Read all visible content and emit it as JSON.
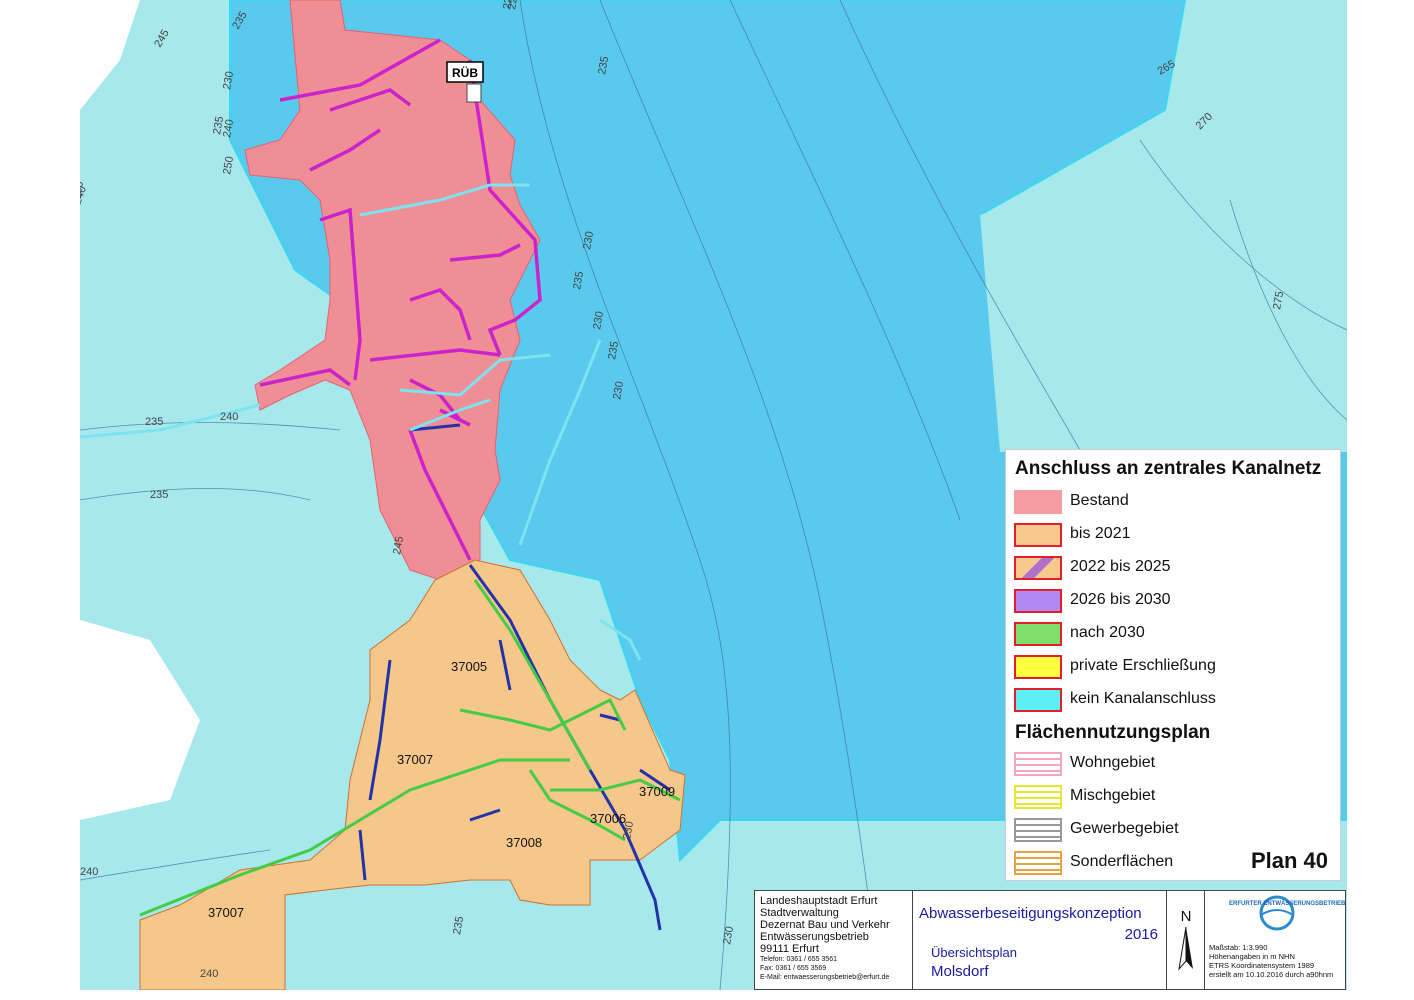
{
  "map": {
    "marker_label": "RÜB",
    "contour_labels": [
      "245",
      "235",
      "230",
      "240",
      "250",
      "225",
      "235",
      "240",
      "235",
      "240",
      "235",
      "245",
      "235",
      "265",
      "270",
      "275",
      "230",
      "235",
      "230",
      "235",
      "240",
      "240",
      "235",
      "230",
      "230",
      "250",
      "230",
      "225"
    ],
    "zone_labels": [
      "37005",
      "37007",
      "37009",
      "37006",
      "37008",
      "37007"
    ],
    "colors": {
      "background_outside": "#a6e8ec",
      "catchment": "#5ac9ee",
      "bestand": "#ef8f95",
      "bis_2021": "#f5c78a",
      "pipe_magenta": "#cc22cc",
      "pipe_blue": "#2233aa",
      "pipe_green": "#44cc44",
      "pipe_cyan": "#7de3f0"
    }
  },
  "legend": {
    "title_connection": "Anschluss an zentrales Kanalnetz",
    "items_connection": [
      {
        "label": "Bestand",
        "fill": "#f59ca0",
        "border": "#f59ca0"
      },
      {
        "label": "bis 2021",
        "fill": "#f7c98c",
        "border": "#e0202a"
      },
      {
        "label": "2022 bis 2025",
        "fill": "#f7c98c",
        "border": "#e0202a",
        "stripe": "#b070d0"
      },
      {
        "label": "2026 bis 2030",
        "fill": "#b388f0",
        "border": "#e0202a"
      },
      {
        "label": "nach 2030",
        "fill": "#7ee06a",
        "border": "#e0202a"
      },
      {
        "label": "private Erschließung",
        "fill": "#ffff40",
        "border": "#e0202a"
      },
      {
        "label": "kein Kanalanschluss",
        "fill": "#5eeef6",
        "border": "#e0202a"
      }
    ],
    "title_land_use": "Flächennutzungsplan",
    "items_land_use": [
      {
        "label": "Wohngebiet",
        "color": "#f2a6c0"
      },
      {
        "label": "Mischgebiet",
        "color": "#e6e630"
      },
      {
        "label": "Gewerbegebiet",
        "color": "#999999"
      },
      {
        "label": "Sonderflächen",
        "color": "#e8a040"
      }
    ],
    "plan_label": "Plan 40"
  },
  "titleblock": {
    "org_lines": [
      "Landeshauptstadt Erfurt",
      "Stadtverwaltung",
      "Dezernat Bau und Verkehr",
      "Entwässerungsbetrieb",
      "99111 Erfurt"
    ],
    "org_small": [
      "Telefon: 0361 / 655 3561",
      "Fax:      0361 / 655 3569",
      "E-Mail: entwaesserungsbetrieb@erfurt.de"
    ],
    "project_title": "Abwasserbeseitigungskonzeption",
    "project_year": "2016",
    "plan_type": "Übersichtsplan",
    "locality": "Molsdorf",
    "north_label": "N",
    "logo_text": "ERFURTER ENTWÄSSERUNGSBETRIEB",
    "meta_lines": [
      "Maßstab:    1:3.990",
      "Höhenangaben in m NHN",
      "ETRS Koordinatensystem 1989",
      "erstellt am 10.10.2016  durch a90hnm"
    ]
  }
}
